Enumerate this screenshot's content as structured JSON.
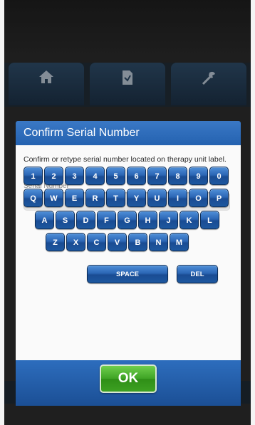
{
  "tabs": [
    {
      "icon": "home-icon"
    },
    {
      "icon": "document-icon"
    },
    {
      "icon": "tools-icon"
    }
  ],
  "dialog": {
    "title": "Confirm Serial Number",
    "instruction": "Confirm or retype serial number located on therapy unit label.",
    "serial_label": "Serial Number",
    "serial_value": "",
    "serial_placeholder": ""
  },
  "keyboard": {
    "row1": [
      "1",
      "2",
      "3",
      "4",
      "5",
      "6",
      "7",
      "8",
      "9",
      "0"
    ],
    "row2": [
      "Q",
      "W",
      "E",
      "R",
      "T",
      "Y",
      "U",
      "I",
      "O",
      "P"
    ],
    "row3": [
      "A",
      "S",
      "D",
      "F",
      "G",
      "H",
      "J",
      "K",
      "L"
    ],
    "row4": [
      "Z",
      "X",
      "C",
      "V",
      "B",
      "N",
      "M"
    ],
    "space_label": "SPACE",
    "delete_label": "DEL"
  },
  "footer": {
    "ok_label": "OK"
  },
  "colors": {
    "header_blue": "#2f6dbd",
    "key_blue": "#2b66b5",
    "ok_green": "#3ea325"
  }
}
